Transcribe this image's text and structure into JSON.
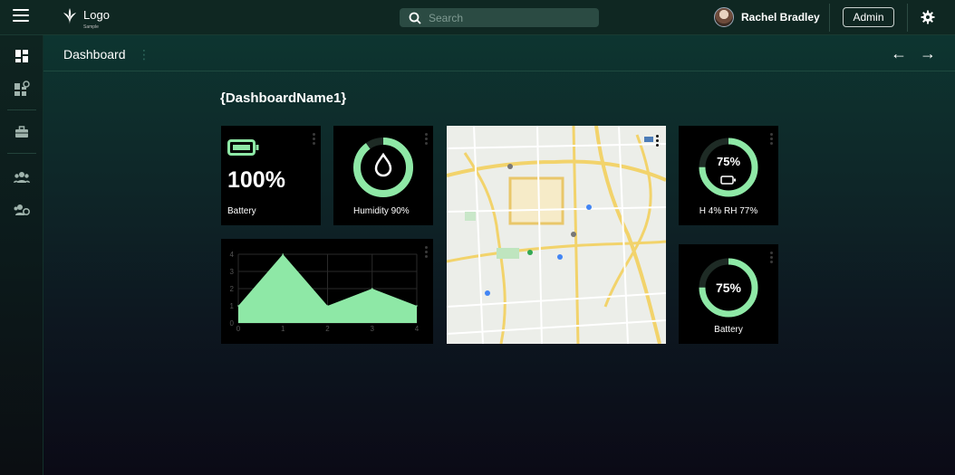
{
  "topbar": {
    "logo_text": "Logo",
    "logo_sub": "Sample",
    "search_placeholder": "Search",
    "user_name": "Rachel Bradley",
    "role_label": "Admin"
  },
  "sidebar": {
    "items": [
      {
        "icon": "dashboard-icon"
      },
      {
        "icon": "dashboard-settings-icon"
      },
      {
        "icon": "briefcase-icon"
      },
      {
        "icon": "users-group-icon"
      },
      {
        "icon": "users-settings-icon"
      }
    ]
  },
  "page": {
    "title": "Dashboard",
    "dashboard_name": "{DashboardName1}"
  },
  "widgets": {
    "battery": {
      "value": "100%",
      "label": "Battery"
    },
    "humidity": {
      "label": "Humidity 90%",
      "level": 0.9
    },
    "env": {
      "value": "75%",
      "label": "H 4% RH 77%",
      "level": 0.75
    },
    "battery2": {
      "value": "75%",
      "label": "Battery",
      "level": 0.75
    }
  },
  "chart_data": {
    "type": "area",
    "x": [
      0,
      1,
      2,
      3,
      4
    ],
    "values": [
      1,
      4,
      1,
      2,
      1
    ],
    "xticks": [
      "0",
      "1",
      "2",
      "3",
      "4"
    ],
    "yticks": [
      "0",
      "1",
      "2",
      "3",
      "4"
    ],
    "xlim": [
      0,
      4
    ],
    "ylim": [
      0,
      4
    ],
    "grid": true,
    "title": "",
    "xlabel": "",
    "ylabel": ""
  },
  "colors": {
    "accent": "#8ee8a6",
    "ring_track": "#1e2b25",
    "topbar": "#0f2722"
  }
}
